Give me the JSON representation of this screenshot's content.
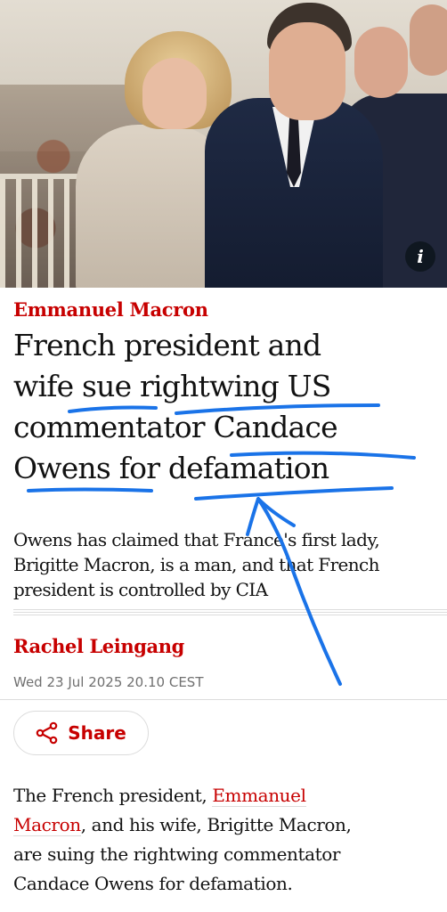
{
  "hero": {
    "info_icon": "i"
  },
  "article": {
    "kicker": "Emmanuel Macron",
    "headline_lines": [
      "French president and",
      "wife sue rightwing US",
      "commentator Candace",
      "Owens for defamation"
    ],
    "standfirst_lines": [
      "Owens has claimed that France's first lady,",
      "Brigitte Macron, is a man, and that French",
      "president is controlled by CIA"
    ],
    "byline": "Rachel Leingang",
    "dateline": "Wed 23 Jul 2025 20.10 CEST",
    "share_label": "Share",
    "body": {
      "l1_pre": "The French president, ",
      "l1_link": "Emmanuel",
      "l2_link": "Macron",
      "l2_post": ", and his wife, Brigitte Macron,",
      "l3": "are suing the rightwing commentator",
      "l4": "Candace Owens for defamation."
    }
  },
  "colors": {
    "accent_red": "#c70000",
    "text": "#121212",
    "meta_grey": "#707070",
    "annotation_blue": "#1a73e8"
  },
  "icons": {
    "info": "info-icon",
    "share": "share-icon"
  }
}
